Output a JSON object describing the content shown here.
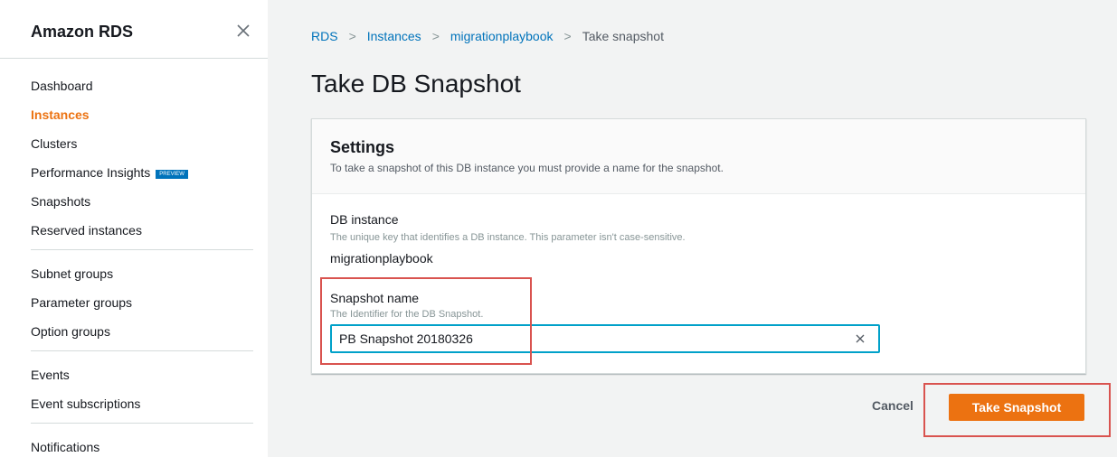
{
  "sidebar": {
    "title": "Amazon RDS",
    "close_icon": "close-icon",
    "groups": [
      [
        {
          "label": "Dashboard",
          "active": false
        },
        {
          "label": "Instances",
          "active": true
        },
        {
          "label": "Clusters",
          "active": false
        },
        {
          "label": "Performance Insights",
          "active": false,
          "badge": "PREVIEW"
        },
        {
          "label": "Snapshots",
          "active": false
        },
        {
          "label": "Reserved instances",
          "active": false
        }
      ],
      [
        {
          "label": "Subnet groups",
          "active": false
        },
        {
          "label": "Parameter groups",
          "active": false
        },
        {
          "label": "Option groups",
          "active": false
        }
      ],
      [
        {
          "label": "Events",
          "active": false
        },
        {
          "label": "Event subscriptions",
          "active": false
        }
      ],
      [
        {
          "label": "Notifications",
          "active": false
        }
      ]
    ]
  },
  "breadcrumb": {
    "items": [
      "RDS",
      "Instances",
      "migrationplaybook"
    ],
    "current": "Take snapshot"
  },
  "page_title": "Take DB Snapshot",
  "settings": {
    "title": "Settings",
    "description": "To take a snapshot of this DB instance you must provide a name for the snapshot.",
    "db_instance": {
      "label": "DB instance",
      "hint": "The unique key that identifies a DB instance. This parameter isn't case-sensitive.",
      "value": "migrationplaybook"
    },
    "snapshot_name": {
      "label": "Snapshot name",
      "hint": "The Identifier for the DB Snapshot.",
      "value": "PB Snapshot 20180326"
    }
  },
  "actions": {
    "cancel_label": "Cancel",
    "take_snapshot_label": "Take Snapshot"
  },
  "colors": {
    "accent": "#ec7211",
    "link": "#0073bb",
    "focus": "#00a1c9",
    "highlight": "#d9534f"
  }
}
